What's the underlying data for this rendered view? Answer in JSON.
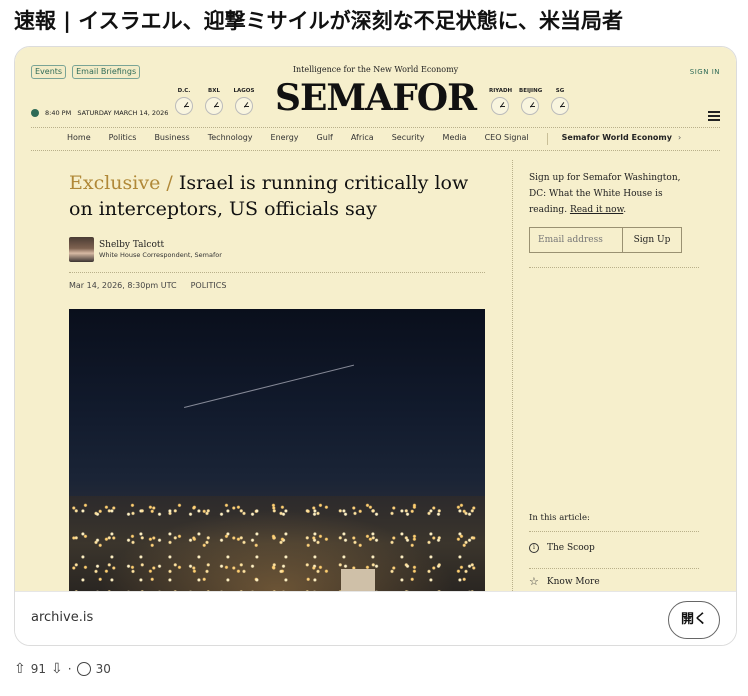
{
  "post": {
    "title": "速報 | イスラエル、迎撃ミサイルが深刻な不足状態に、米当局者"
  },
  "preview": {
    "top_links": [
      "Events",
      "Email Briefings"
    ],
    "tagline": "Intelligence for the New World Economy",
    "sign_in": "SIGN IN",
    "clocks_left": [
      "D.C.",
      "BXL",
      "LAGOS"
    ],
    "clocks_right": [
      "RIYADH",
      "BEIJING",
      "SG"
    ],
    "logo": "SEMAFOR",
    "datetime": "8:40 PM   SATURDAY MARCH 14, 2026",
    "nav": [
      "Home",
      "Politics",
      "Business",
      "Technology",
      "Energy",
      "Gulf",
      "Africa",
      "Security",
      "Media",
      "CEO Signal"
    ],
    "nav_feature": "Semafor World Economy",
    "nav_arrow": "›",
    "headline_prefix": "Exclusive /",
    "headline": "Israel is running critically low on interceptors, US officials say",
    "author_name": "Shelby Talcott",
    "author_role": "White House Correspondent, Semafor",
    "date": "Mar 14, 2026, 8:30pm UTC",
    "section": "POLITICS",
    "signup_text": "Sign up for Semafor Washington, DC: What the White House is reading.",
    "signup_link": "Read it now",
    "signup_period": ".",
    "email_placeholder": "Email address",
    "signup_button": "Sign Up",
    "in_article": "In this article:",
    "toc": [
      "The Scoop",
      "Know More"
    ]
  },
  "card": {
    "domain": "archive.is",
    "open_button": "開く"
  },
  "actions": {
    "upvotes": "91",
    "separator": "·",
    "comments": "30"
  },
  "colors": {
    "preview_bg": "#f6efcc",
    "exclusive": "#b08837",
    "pill_green": "#2f6b57"
  }
}
